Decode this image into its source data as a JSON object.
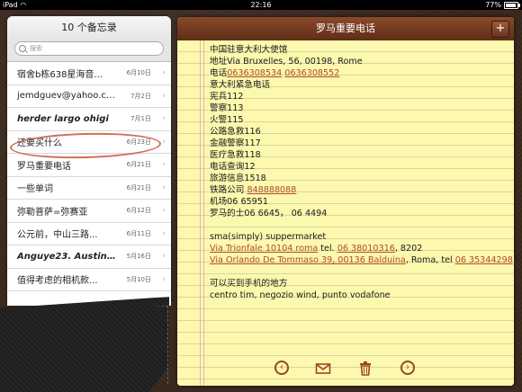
{
  "status": {
    "device": "iPad",
    "time": "22:16",
    "battery": "77%"
  },
  "list": {
    "title": "10 个备忘录",
    "search_placeholder": "搜索",
    "notes": [
      {
        "title": "宿舍b栋638星海音...",
        "date": "6月10日",
        "bold": false
      },
      {
        "title": "jemdguev@yahoo.co...",
        "date": "7月2日",
        "bold": false
      },
      {
        "title": "herder largo ohigi",
        "date": "7月1日",
        "bold": true
      },
      {
        "title": "还要买什么",
        "date": "6月23日",
        "bold": false
      },
      {
        "title": "罗马重要电话",
        "date": "6月21日",
        "bold": false
      },
      {
        "title": "一些单词",
        "date": "6月21日",
        "bold": false
      },
      {
        "title": "弥勒菩萨=弥赛亚",
        "date": "6月12日",
        "bold": false
      },
      {
        "title": "公元前，中山三路...",
        "date": "6月11日",
        "bold": false
      },
      {
        "title": "Anguye23. Austinh...",
        "date": "5月16日",
        "bold": true
      },
      {
        "title": "值得考虑的相机款...",
        "date": "5月10日",
        "bold": false
      }
    ]
  },
  "note": {
    "title": "罗马重要电话",
    "add_label": "+",
    "lines": [
      {
        "parts": [
          {
            "t": "中国驻意大利大使馆"
          }
        ]
      },
      {
        "parts": [
          {
            "t": "地址Via Bruxelles, 56, 00198, Rome"
          }
        ]
      },
      {
        "parts": [
          {
            "t": "电话"
          },
          {
            "t": "0636308534",
            "link": true
          },
          {
            "t": " "
          },
          {
            "t": "0636308552",
            "link": true
          }
        ]
      },
      {
        "parts": [
          {
            "t": "意大利紧急电话"
          }
        ]
      },
      {
        "parts": [
          {
            "t": "宪兵112"
          }
        ]
      },
      {
        "parts": [
          {
            "t": "警察113"
          }
        ]
      },
      {
        "parts": [
          {
            "t": "火警115"
          }
        ]
      },
      {
        "parts": [
          {
            "t": "公路急救116"
          }
        ]
      },
      {
        "parts": [
          {
            "t": "金融警察117"
          }
        ]
      },
      {
        "parts": [
          {
            "t": "医疗急救118"
          }
        ]
      },
      {
        "parts": [
          {
            "t": "电话查询12"
          }
        ]
      },
      {
        "parts": [
          {
            "t": "旅游信息1518"
          }
        ]
      },
      {
        "parts": [
          {
            "t": "铁路公司 "
          },
          {
            "t": "848888088",
            "link": true
          }
        ]
      },
      {
        "parts": [
          {
            "t": "机场06 65951"
          }
        ]
      },
      {
        "parts": [
          {
            "t": "罗马的士06 6645，  06 4494"
          }
        ]
      },
      {
        "parts": [
          {
            "t": ""
          }
        ]
      },
      {
        "parts": [
          {
            "t": "sma(simply)  suppermarket"
          }
        ]
      },
      {
        "parts": [
          {
            "t": "Via Trionfale 10104 roma",
            "link": true
          },
          {
            "t": " tel. "
          },
          {
            "t": "06 38010316",
            "link": true
          },
          {
            "t": ", 8202"
          }
        ]
      },
      {
        "parts": [
          {
            "t": "Via Orlando De Tommaso 39, 00136 Balduina",
            "link": true
          },
          {
            "t": ", Roma, tel "
          },
          {
            "t": "06 35344298",
            "link": true
          }
        ]
      },
      {
        "parts": [
          {
            "t": ""
          }
        ]
      },
      {
        "parts": [
          {
            "t": "可以买到手机的地方"
          }
        ]
      },
      {
        "parts": [
          {
            "t": "centro tim, negozio wind, punto vodafone"
          }
        ]
      }
    ]
  },
  "toolbar": {
    "back_icon": "left-arrow-circle",
    "mail_icon": "envelope",
    "trash_icon": "trash-can",
    "forward_icon": "right-arrow-circle"
  },
  "colors": {
    "link": "#b04a2a",
    "header": "#6b3620",
    "paper": "#fcf8ad"
  }
}
